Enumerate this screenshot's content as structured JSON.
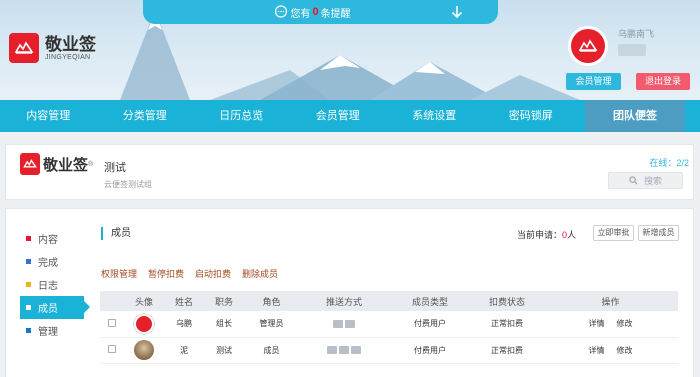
{
  "notice": {
    "prefix": "您有",
    "count": "0",
    "suffix": "条提醒"
  },
  "brand": {
    "name_cn": "敬业签",
    "name_en": "JINGYEQIAN"
  },
  "user": {
    "name": "乌鹏南飞",
    "member_btn": "会员管理",
    "logout_btn": "退出登录"
  },
  "nav": {
    "items": [
      "内容管理",
      "分类管理",
      "日历总览",
      "会员管理",
      "系统设置",
      "密码锁屏",
      "团队便签"
    ],
    "active": "团队便签"
  },
  "team": {
    "logo_cn": "敬业签",
    "reg": "®",
    "name": "测试",
    "desc": "云便签测试组",
    "online_label": "在线：",
    "online_value": "2/2",
    "search_placeholder": "搜索"
  },
  "sidebar": {
    "items": [
      {
        "label": "内容",
        "color": "#e8132f"
      },
      {
        "label": "完成",
        "color": "#3b6fd8"
      },
      {
        "label": "日志",
        "color": "#e9b31c"
      },
      {
        "label": "成员",
        "color": "#1ab2d6"
      },
      {
        "label": "管理",
        "color": "#1a76c9"
      }
    ],
    "active": "成员"
  },
  "members": {
    "title": "成员",
    "pending_label": "当前申请：",
    "pending_count": "0",
    "pending_unit": "人",
    "btn_approve": "立即审批",
    "btn_add": "新增成员",
    "actions": [
      "权限管理",
      "暂停扣费",
      "启动扣费",
      "删除成员"
    ],
    "columns": [
      "",
      "头像",
      "姓名",
      "职务",
      "角色",
      "推送方式",
      "成员类型",
      "扣费状态",
      "操作"
    ],
    "rows": [
      {
        "name": "乌鹏",
        "title": "组长",
        "role": "管理员",
        "type": "付费用户",
        "billing": "正常扣费",
        "detail": "详情",
        "edit": "修改"
      },
      {
        "name": "泥",
        "title": "测试",
        "role": "成员",
        "type": "付费用户",
        "billing": "正常扣费",
        "detail": "详情",
        "edit": "修改"
      }
    ]
  }
}
